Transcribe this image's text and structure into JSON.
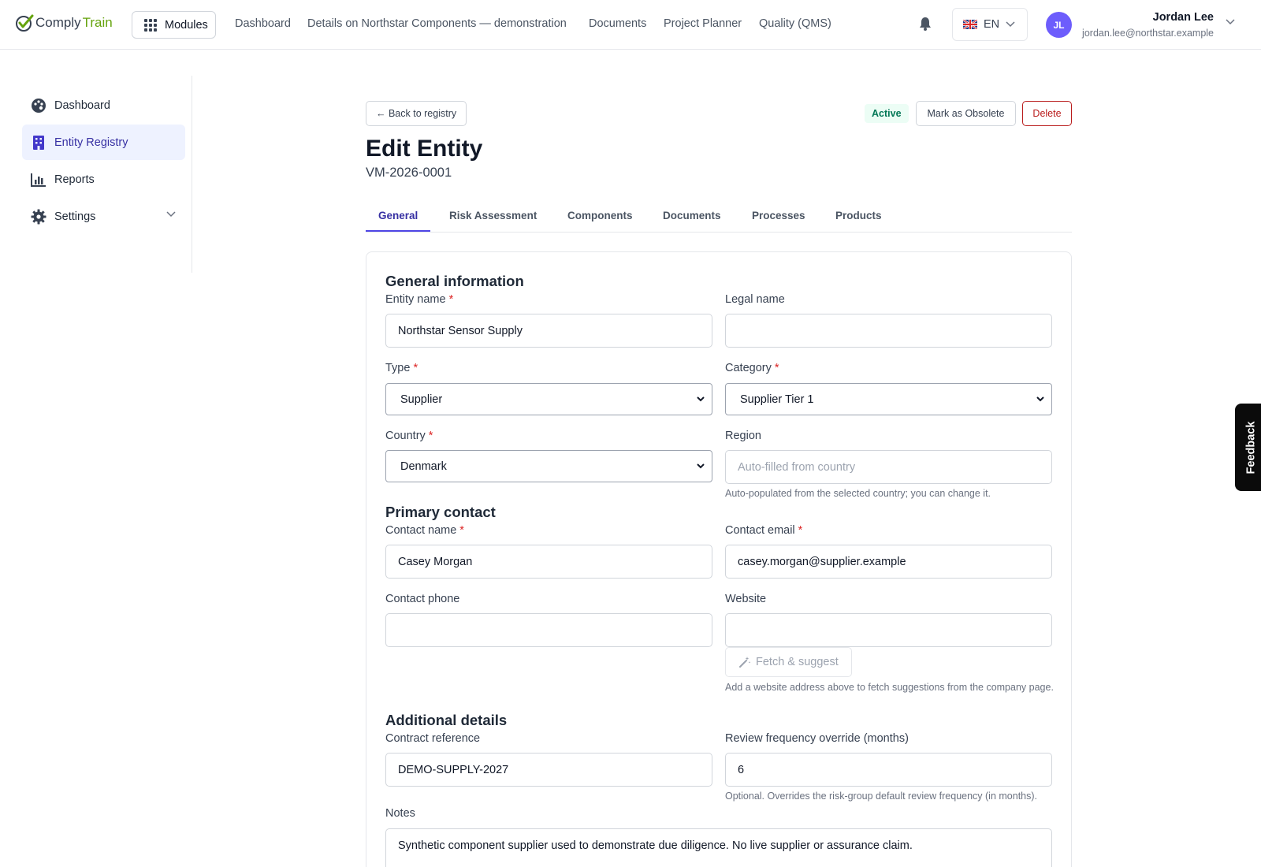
{
  "app": {
    "logo_part1": "Comply",
    "logo_part2": "Train",
    "modules_label": "Modules",
    "nav": [
      "Dashboard",
      "Details on Northstar Components — demonstration",
      "Documents",
      "Project Planner",
      "Quality (QMS)"
    ],
    "language": "EN",
    "user": {
      "initials": "JL",
      "name": "Jordan Lee",
      "email": "jordan.lee@northstar.example"
    }
  },
  "sidebar": {
    "items": [
      {
        "label": "Dashboard",
        "icon": "palette-icon"
      },
      {
        "label": "Entity Registry",
        "icon": "building-icon",
        "active": true
      },
      {
        "label": "Reports",
        "icon": "bar-chart-icon"
      },
      {
        "label": "Settings",
        "icon": "gear-icon"
      }
    ]
  },
  "header": {
    "back_label": "← Back to registry",
    "status": "Active",
    "obsolete_label": "Mark as Obsolete",
    "delete_label": "Delete",
    "title": "Edit Entity",
    "code": "VM-2026-0001"
  },
  "tabs": [
    "General",
    "Risk Assessment",
    "Components",
    "Documents",
    "Processes",
    "Products"
  ],
  "form": {
    "general_title": "General information",
    "entity_name": {
      "label": "Entity name",
      "value": "Northstar Sensor Supply"
    },
    "legal_name": {
      "label": "Legal name",
      "value": ""
    },
    "type": {
      "label": "Type",
      "value": "Supplier"
    },
    "category": {
      "label": "Category",
      "value": "Supplier Tier 1"
    },
    "country": {
      "label": "Country",
      "value": "Denmark"
    },
    "region": {
      "label": "Region",
      "placeholder": "Auto-filled from country",
      "help": "Auto-populated from the selected country; you can change it."
    },
    "contact_title": "Primary contact",
    "contact_name": {
      "label": "Contact name",
      "value": "Casey Morgan"
    },
    "contact_email": {
      "label": "Contact email",
      "value": "casey.morgan@supplier.example"
    },
    "contact_phone": {
      "label": "Contact phone",
      "value": ""
    },
    "website": {
      "label": "Website",
      "value": "",
      "fetch_label": "Fetch & suggest",
      "help": "Add a website address above to fetch suggestions from the company page."
    },
    "additional_title": "Additional details",
    "contract_ref": {
      "label": "Contract reference",
      "value": "DEMO-SUPPLY-2027"
    },
    "review_freq": {
      "label": "Review frequency override (months)",
      "value": "6",
      "help": "Optional. Overrides the risk-group default review frequency (in months)."
    },
    "notes": {
      "label": "Notes",
      "value": "Synthetic component supplier used to demonstrate due diligence. No live supplier or assurance claim."
    }
  },
  "feedback_label": "Feedback",
  "colors": {
    "accent": "#4f46e5",
    "brand_green": "#65a30d",
    "danger": "#b91c1c",
    "success": "#047857"
  }
}
